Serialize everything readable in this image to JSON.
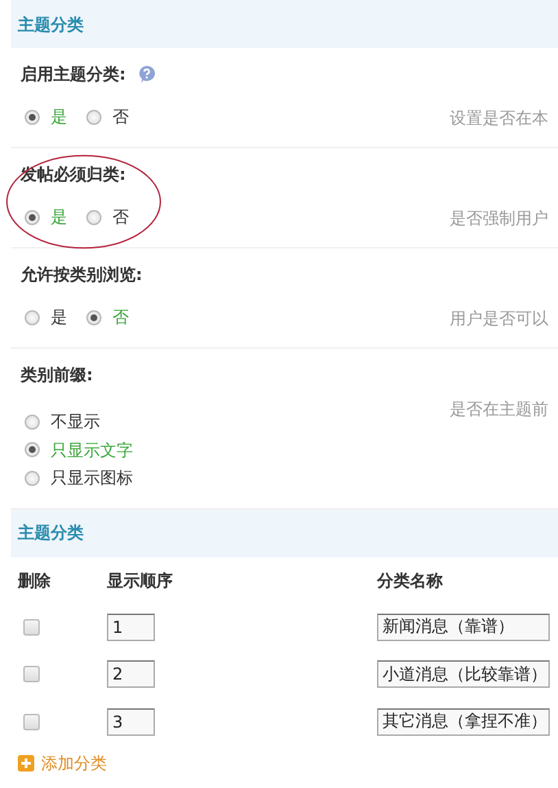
{
  "sections": [
    {
      "title": "主题分类"
    },
    {
      "title": "主题分类"
    }
  ],
  "settings": [
    {
      "label": "启用主题分类:",
      "help": true,
      "annotated": false,
      "options": [
        {
          "label": "是",
          "selected": true
        },
        {
          "label": "否",
          "selected": false
        }
      ],
      "kind": "inline",
      "description": "设置是否在本"
    },
    {
      "label": "发帖必须归类:",
      "help": false,
      "annotated": true,
      "options": [
        {
          "label": "是",
          "selected": true
        },
        {
          "label": "否",
          "selected": false
        }
      ],
      "kind": "inline",
      "description": "是否强制用户"
    },
    {
      "label": "允许按类别浏览:",
      "help": false,
      "annotated": false,
      "options": [
        {
          "label": "是",
          "selected": false
        },
        {
          "label": "否",
          "selected": true
        }
      ],
      "kind": "inline",
      "description": "用户是否可以"
    },
    {
      "label": "类别前缀:",
      "help": false,
      "annotated": false,
      "options": [
        {
          "label": "不显示",
          "selected": false
        },
        {
          "label": "只显示文字",
          "selected": true
        },
        {
          "label": "只显示图标",
          "selected": false
        }
      ],
      "kind": "stacked",
      "description": "是否在主题前"
    }
  ],
  "table": {
    "columns": [
      "删除",
      "显示顺序",
      "分类名称"
    ],
    "rows": [
      {
        "checked": false,
        "order": "1",
        "name": "新闻消息（靠谱）"
      },
      {
        "checked": false,
        "order": "2",
        "name": "小道消息（比较靠谱）"
      },
      {
        "checked": false,
        "order": "3",
        "name": "其它消息（拿捏不准）"
      }
    ]
  },
  "add_link": "添加分类"
}
